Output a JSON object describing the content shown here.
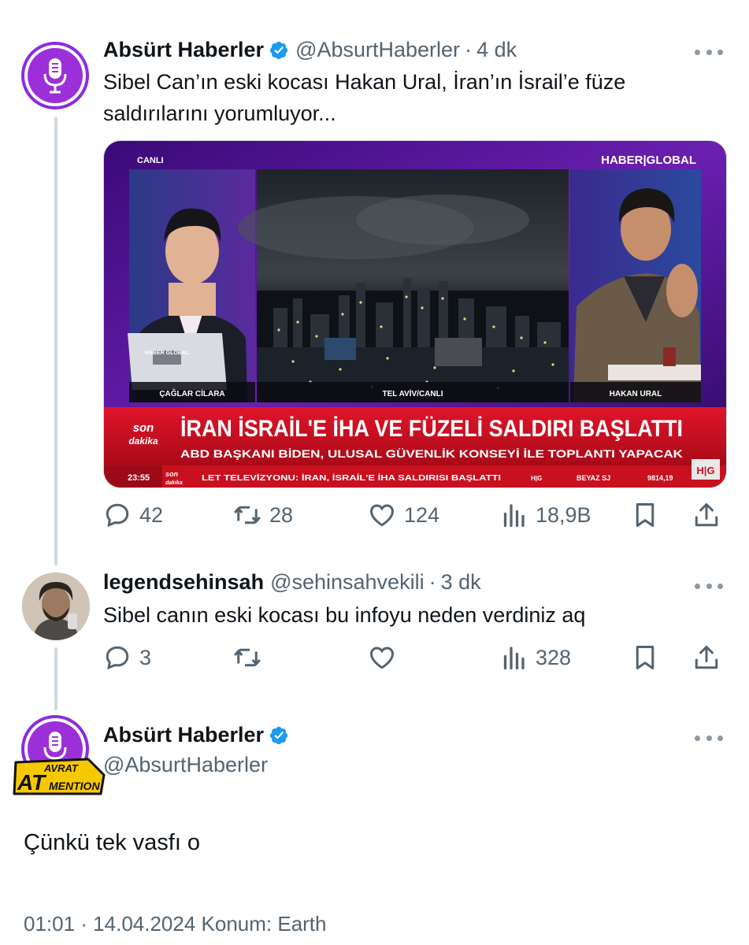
{
  "tweets": [
    {
      "name": "Absürt Haberler",
      "handle": "@AbsurtHaberler",
      "time": "4 dk",
      "text_line1": "Sibel Can’ın eski kocası Hakan Ural, İran’ın İsrail’e füze",
      "text_line2": "saldırılarını yorumluyor...",
      "replies": "42",
      "retweets": "28",
      "likes": "124",
      "views": "18,9B"
    },
    {
      "name": "legendsehinsah",
      "handle": "@sehinsahvekili",
      "time": "3 dk",
      "text": "Sibel canın eski kocası bu infoyu neden verdiniz aq",
      "replies": "3",
      "views": "328"
    },
    {
      "name": "Absürt Haberler",
      "handle": "@AbsurtHaberler",
      "text": "Çünkü tek vasfı o",
      "footer": "01:01 · 14.04.2024 Konum: Earth"
    }
  ],
  "broadcast": {
    "live_label": "CANLI",
    "channel_logo": "HABER|GLOBAL",
    "left_caption": "ÇAĞLAR CİLARA",
    "center_caption": "TEL AVİV/CANLI",
    "right_caption": "HAKAN URAL",
    "breaking_label_1": "son",
    "breaking_label_2": "dakika",
    "headline": "İRAN İSRAİL'E İHA VE FÜZELİ SALDIRI BAŞLATTI",
    "subheadline": "ABD BAŞKANI BİDEN, ULUSAL GÜVENLİK KONSEYİ İLE TOPLANTI YAPACAK",
    "ticker_time": "23:55",
    "ticker_text": "LET TELEVİZYONU: İRAN, İSRAİL'E İHA SALDIRISI BAŞLATTI",
    "ticker_tag": "H|G",
    "ticker_market": "BEYAZ SJ",
    "ticker_index": "9814,19",
    "corner_logo": "H|G",
    "laptop_label": "HABER GLOBAL"
  },
  "sticker": {
    "line1": "AVRAT",
    "line2": "AT",
    "line3": "MENTION"
  },
  "colors": {
    "verified": "#1d9bf0",
    "avatar_purple": "#8a2be2",
    "text_secondary": "#536471",
    "thread_line": "#cfd9de",
    "breaking_red": "#d40d1f"
  },
  "icons": [
    "reply-icon",
    "retweet-icon",
    "like-icon",
    "views-icon",
    "bookmark-icon",
    "share-icon",
    "verified-icon",
    "microphone-icon",
    "more-icon"
  ]
}
